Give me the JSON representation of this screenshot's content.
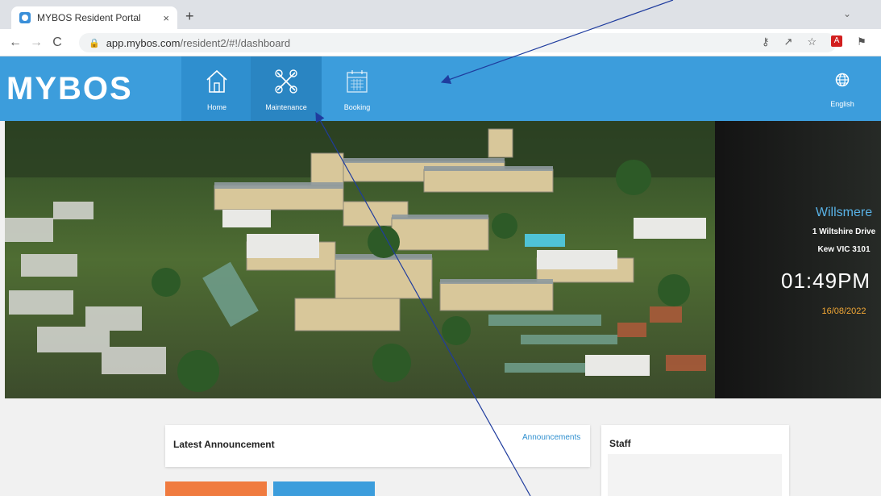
{
  "browser": {
    "tab_title": "MYBOS Resident Portal",
    "tab_close": "×",
    "new_tab": "+",
    "url_host": "app.mybos.com",
    "url_path": "/resident2/#!/dashboard"
  },
  "header": {
    "logo": "MYBOS",
    "nav": [
      {
        "label": "Home",
        "icon": "home-icon"
      },
      {
        "label": "Maintenance",
        "icon": "tools-icon"
      },
      {
        "label": "Booking",
        "icon": "calendar-icon"
      }
    ],
    "language": {
      "label": "English",
      "icon": "globe-icon"
    }
  },
  "building": {
    "name": "Willsmere",
    "address_line1": "1 Wiltshire Drive",
    "address_line2": "Kew VIC 3101",
    "time": "01:49PM",
    "date": "16/08/2022"
  },
  "announcement": {
    "title": "Latest Announcement",
    "link": "Announcements"
  },
  "staff": {
    "title": "Staff"
  },
  "colors": {
    "header_blue": "#3c9ddc",
    "date_orange": "#f2a735",
    "name_blue": "#59b2e6",
    "tile_orange": "#f07b3f",
    "annotation_arrow": "#1f3c9e"
  }
}
